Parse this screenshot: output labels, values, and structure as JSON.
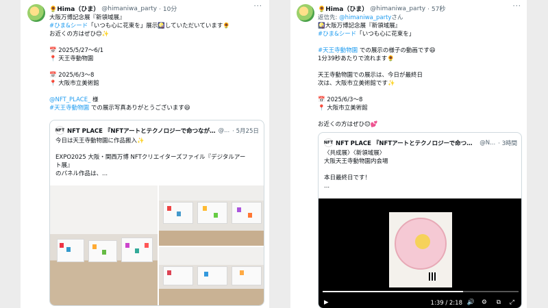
{
  "left_post": {
    "display_name": "🌻Hima（ひま）",
    "handle": "@himaniwa_party",
    "time": "· 10分",
    "more": "···",
    "lines": [
      "大阪万博記念展『新領域展』",
      "#ひま&シード「いつも心に花束を」展示🎑していただいています🌻",
      "お近くの方はぜひ😊✨",
      "",
      "📅 2025/5/27〜6/1",
      "📍 天王寺動物園",
      "",
      "📅 2025/6/3〜8",
      "📍 大阪市立美術館",
      "",
      "@NFT_PLACE_ 様",
      "#天王寺動物園 での展示写真ありがとうございます😆"
    ],
    "link_hashtag": "#ひま&シード",
    "line2_rest": "「いつも心に花束を」展示🎑していただいています🌻",
    "mention": "@NFT_PLACE_",
    "mention_rest": " 様",
    "hashtag_zoo": "#天王寺動物園",
    "hashtag_zoo_rest": " での展示写真ありがとうございます😆",
    "quote": {
      "avatar_text": "NFT",
      "name": "NFT PLACE 『NFTアートとテクノロジーで命つなが…",
      "handle": "@...",
      "date": "· 5月25日",
      "lines": [
        "今日は天王寺動物園に作品搬入✨",
        "",
        "EXPO2025 大阪・関西万博 NFTクリエイターズファイル『デジタルアー",
        "ト展』",
        "のパネル作品は、..."
      ]
    }
  },
  "right_post": {
    "display_name": "🌻Hima（ひま）",
    "handle": "@himaniwa_party",
    "time": "· 57秒",
    "more": "···",
    "reply_prefix": "返信先: ",
    "reply_handle": "@himaniwa_party",
    "reply_suffix": "さん",
    "lines": [
      "🎑大阪万博記念展『新領域展』",
      "#ひま&シード「いつも心に花束を」",
      "",
      "#天王寺動物園 での展示の様子の動画です😆",
      "1分39秒あたりで流れます🌻",
      "",
      "天王寺動物園での展示は、今日が最終日",
      "次は、大阪市立美術館です✨",
      "",
      "📅 2025/6/3〜8",
      "📍 大阪市立美術館",
      "",
      "お近くの方はぜひ😊💕"
    ],
    "hashtag_hima": "#ひま&シード",
    "hashtag_hima_rest": "「いつも心に花束を」",
    "hashtag_zoo": "#天王寺動物園",
    "hashtag_zoo_rest": " での展示の様子の動画です😆",
    "quote": {
      "avatar_text": "NFT",
      "name": "NFT PLACE 『NFTアートとテクノロジーで命つなが…",
      "handle": "@N...",
      "date": "· 3時間",
      "lines": [
        "〈共成展〉〈新領域展〉",
        "大阪天王寺動物園内会場",
        "",
        "本日最終日です！",
        "..."
      ],
      "video": {
        "current_time": "1:39",
        "duration": "2:18",
        "time_label": "1:39 / 2:18",
        "progress_fraction": 0.717
      }
    }
  },
  "icons": {
    "play": "▶",
    "volume": "🔊",
    "settings": "⚙",
    "pip": "⧉",
    "fullscreen": "⤢",
    "more": "···"
  },
  "colors": {
    "link": "#1d9bf0",
    "muted": "#536471",
    "border": "#cfd9de"
  }
}
